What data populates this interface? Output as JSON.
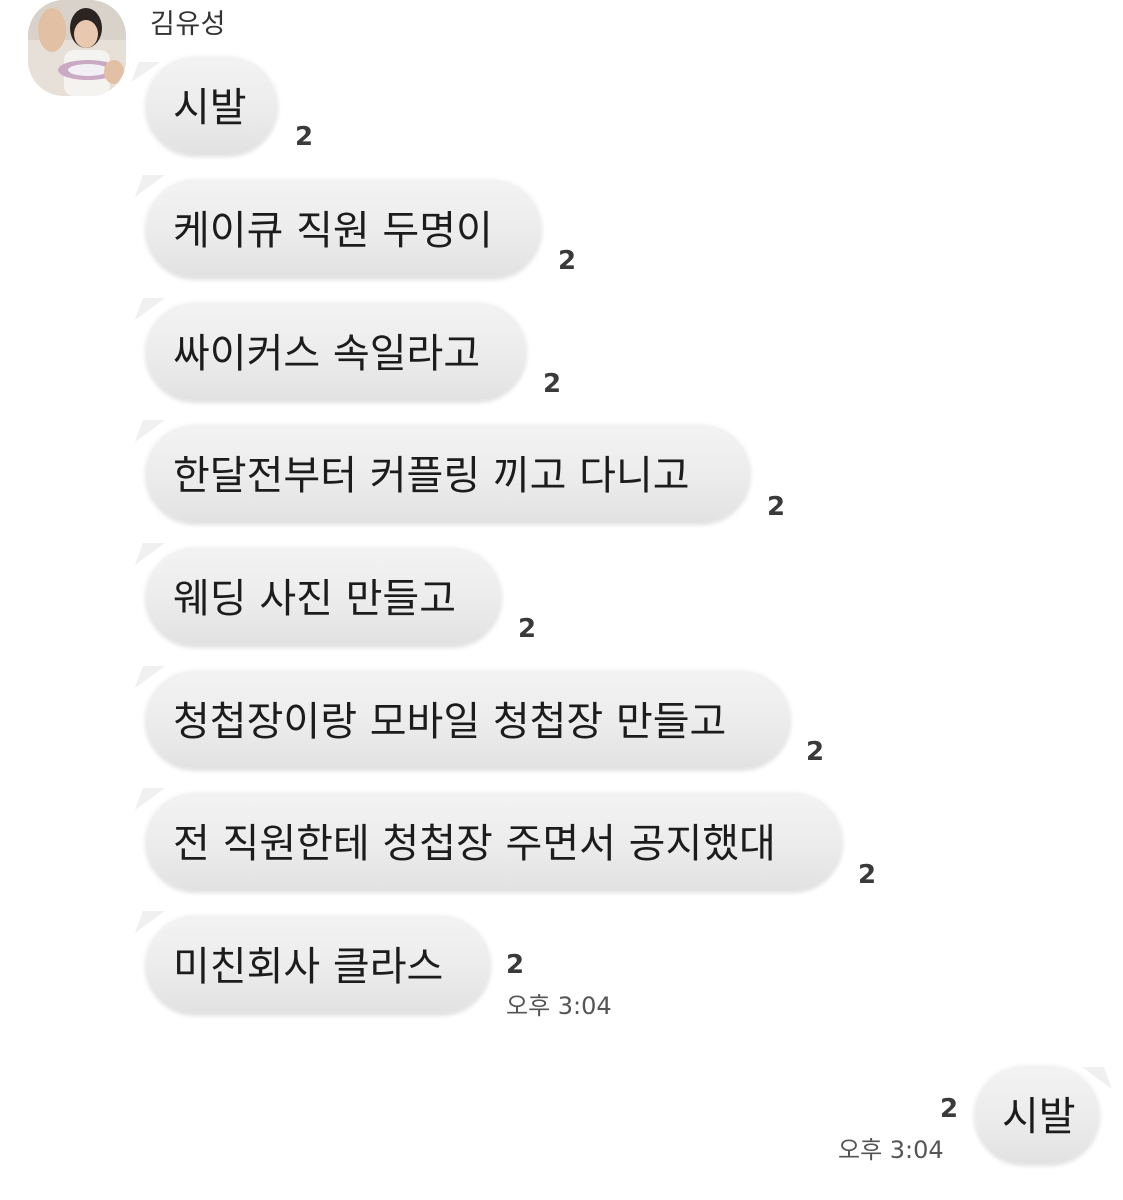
{
  "sender": {
    "name": "김유성"
  },
  "incoming_messages": [
    {
      "text": "시발",
      "unread": "2"
    },
    {
      "text": "케이큐 직원 두명이",
      "unread": "2"
    },
    {
      "text": "싸이커스 속일라고",
      "unread": "2"
    },
    {
      "text": "한달전부터 커플링 끼고 다니고",
      "unread": "2"
    },
    {
      "text": "웨딩 사진 만들고",
      "unread": "2"
    },
    {
      "text": "청첩장이랑 모바일 청첩장 만들고",
      "unread": "2"
    },
    {
      "text": "전 직원한테 청첩장 주면서 공지했대",
      "unread": "2"
    },
    {
      "text": "미친회사 클라스",
      "unread": "2",
      "time": "오후 3:04"
    }
  ],
  "outgoing_messages": [
    {
      "text": "시발",
      "unread": "2",
      "time": "오후 3:04"
    }
  ],
  "colors": {
    "bubble": "#eeeeee",
    "text": "#1c1c1c",
    "meta": "#555555"
  }
}
